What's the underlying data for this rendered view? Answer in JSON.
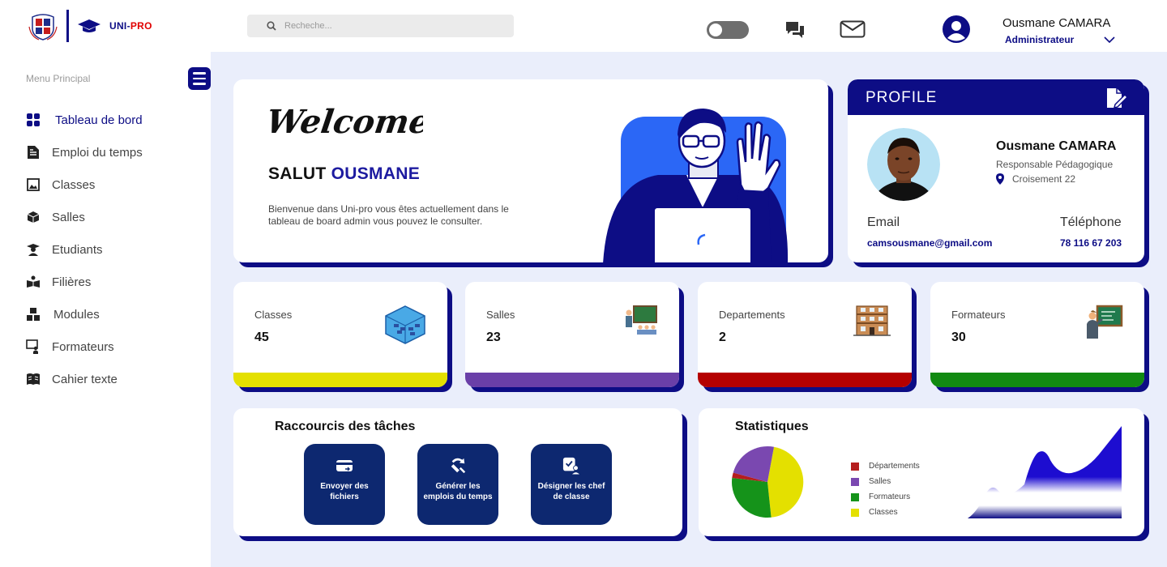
{
  "brand": {
    "uni": "UNI-",
    "pro": "PRO"
  },
  "search": {
    "placeholder": "Recheche..."
  },
  "user": {
    "name": "Ousmane CAMARA",
    "role": "Administrateur"
  },
  "sidebar": {
    "title": "Menu Principal",
    "items": [
      {
        "label": "Tableau de bord",
        "icon": "dashboard-icon",
        "active": true
      },
      {
        "label": "Emploi du temps",
        "icon": "document-icon"
      },
      {
        "label": "Classes",
        "icon": "classroom-icon"
      },
      {
        "label": "Salles",
        "icon": "box-icon"
      },
      {
        "label": "Etudiants",
        "icon": "student-icon"
      },
      {
        "label": "Filières",
        "icon": "book-reader-icon"
      },
      {
        "label": "Modules",
        "icon": "blocks-icon"
      },
      {
        "label": "Formateurs",
        "icon": "teacher-icon"
      },
      {
        "label": "Cahier texte",
        "icon": "open-book-icon"
      }
    ]
  },
  "welcome": {
    "word": "Welcome!",
    "greeting": "SALUT",
    "name": "OUSMANE",
    "text": "Bienvenue dans Uni-pro vous êtes actuellement dans le tableau de board admin vous pouvez le consulter."
  },
  "profile": {
    "title": "PROFILE",
    "name": "Ousmane CAMARA",
    "role": "Responsable Pédagogique",
    "location": "Croisement 22",
    "email_label": "Email",
    "phone_label": "Téléphone",
    "email": "camsousmane@gmail.com",
    "phone": "78 116 67 203"
  },
  "stats": [
    {
      "label": "Classes",
      "value": "45",
      "color": "#e4e000"
    },
    {
      "label": "Salles",
      "value": "23",
      "color": "#6a3fa8"
    },
    {
      "label": "Departements",
      "value": "2",
      "color": "#b50000"
    },
    {
      "label": "Formateurs",
      "value": "30",
      "color": "#128a12"
    }
  ],
  "shortcuts": {
    "title": "Raccourcis des tâches",
    "buttons": [
      {
        "label": "Envoyer des fichiers",
        "icon": "send-file-icon"
      },
      {
        "label": "Générer les emplois du temps",
        "icon": "generate-icon"
      },
      {
        "label": "Désigner les chef de classe",
        "icon": "assign-user-icon"
      }
    ]
  },
  "statistics": {
    "title": "Statistiques",
    "legend": [
      {
        "label": "Départements",
        "color": "#b51e1e"
      },
      {
        "label": "Salles",
        "color": "#7a48b0"
      },
      {
        "label": "Formateurs",
        "color": "#15931a"
      },
      {
        "label": "Classes",
        "color": "#e4e000"
      }
    ]
  },
  "colors": {
    "primary": "#0d0d85",
    "background": "#eaeefb"
  }
}
